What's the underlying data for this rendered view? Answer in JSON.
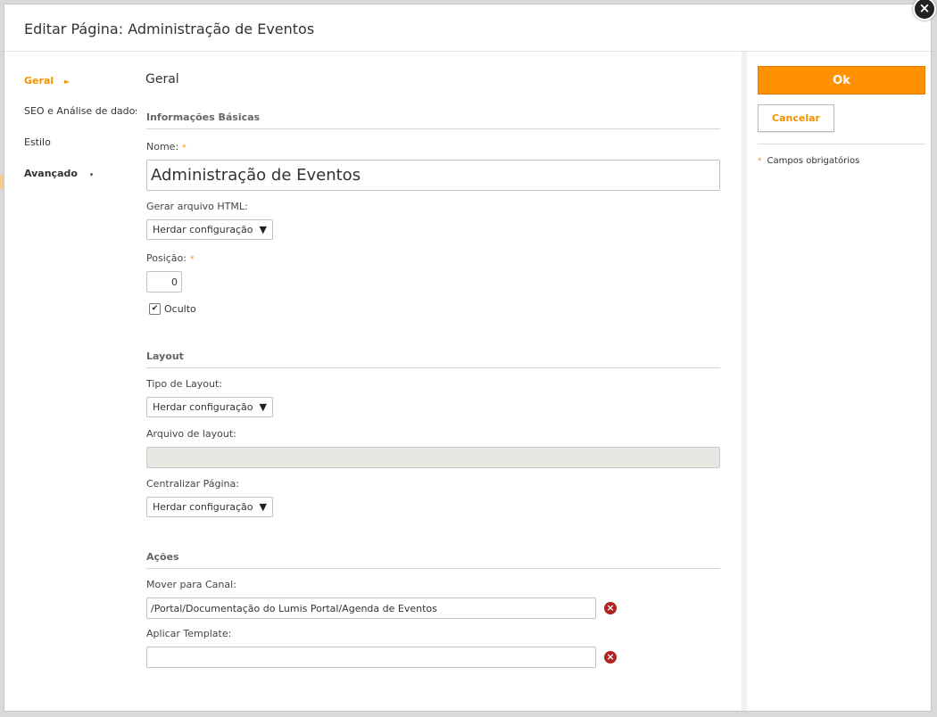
{
  "dialog": {
    "title": "Editar Página: Administração de Eventos",
    "close_symbol": "×"
  },
  "nav": {
    "items": [
      {
        "label": "Geral",
        "indicator": "►",
        "active": true
      },
      {
        "label": "SEO e Análise de dados"
      },
      {
        "label": "Estilo"
      },
      {
        "label": "Avançado",
        "indicator": "▾"
      }
    ]
  },
  "main": {
    "section_title": "Geral",
    "groups": {
      "basic": "Informações Básicas",
      "layout": "Layout",
      "actions": "Ações"
    },
    "fields": {
      "name": {
        "label": "Nome:",
        "value": "Administração de Eventos"
      },
      "html": {
        "label": "Gerar arquivo HTML:",
        "value": "Herdar configuração"
      },
      "position": {
        "label": "Posição:",
        "value": "0"
      },
      "hidden": {
        "label": "Oculto",
        "checked": true
      },
      "layout_type": {
        "label": "Tipo de Layout:",
        "value": "Herdar configuração"
      },
      "layout_file": {
        "label": "Arquivo de layout:",
        "value": ""
      },
      "center_page": {
        "label": "Centralizar Página:",
        "value": "Herdar configuração"
      },
      "move_channel": {
        "label": "Mover para Canal:",
        "value": "/Portal/Documentação do Lumis Portal/Agenda de Eventos"
      },
      "apply_template": {
        "label": "Aplicar Template:",
        "value": ""
      }
    },
    "select_arrow": "▼",
    "required_mark": "*",
    "check_mark": "✔",
    "clear_symbol": "×"
  },
  "side": {
    "ok_label": "Ok",
    "cancel_label": "Cancelar",
    "required_legend": "Campos obrigatórios"
  },
  "colors": {
    "accent": "#ff9000",
    "accent_text": "#f39200",
    "clear_icon": "#b12222"
  }
}
